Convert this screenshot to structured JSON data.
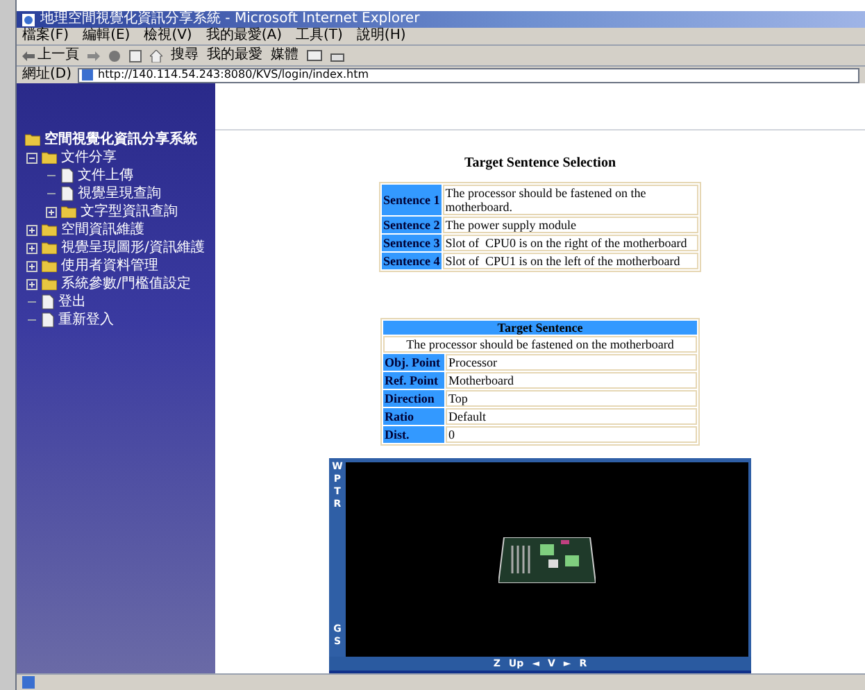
{
  "window": {
    "title": "地理空間視覺化資訊分享系統 - Microsoft Internet Explorer"
  },
  "menu": [
    "檔案(F)",
    "編輯(E)",
    "檢視(V)",
    "我的最愛(A)",
    "工具(T)",
    "說明(H)"
  ],
  "toolbar": {
    "back": "上一頁",
    "search": "搜尋",
    "favorites": "我的最愛",
    "media": "媒體"
  },
  "address": {
    "label": "網址(D)",
    "value": "http://140.114.54.243:8080/KVS/login/index.htm"
  },
  "tree": {
    "label": "空間視覺化資訊分享系統",
    "children": [
      {
        "kind": "folder",
        "label": "文件分享",
        "expanded": true,
        "children": [
          {
            "kind": "document",
            "label": "文件上傳"
          },
          {
            "kind": "document",
            "label": "視覺呈現查詢"
          },
          {
            "kind": "folder",
            "label": "文字型資訊查詢",
            "expanded": false
          }
        ]
      },
      {
        "kind": "folder",
        "label": "空間資訊維護",
        "expanded": false
      },
      {
        "kind": "folder",
        "label": "視覺呈現圖形/資訊維護",
        "expanded": false
      },
      {
        "kind": "folder",
        "label": "使用者資料管理",
        "expanded": false
      },
      {
        "kind": "folder",
        "label": "系統參數/門檻值設定",
        "expanded": false
      },
      {
        "kind": "document",
        "label": "登出"
      },
      {
        "kind": "document",
        "label": "重新登入"
      }
    ]
  },
  "selection": {
    "title": "Target Sentence Selection",
    "rows": [
      {
        "label": "Sentence 1",
        "text": "The processor should be fastened on the motherboard."
      },
      {
        "label": "Sentence 2",
        "text": "The power supply module"
      },
      {
        "label": "Sentence 3",
        "text": "Slot of  CPU0 is on the right of the motherboard"
      },
      {
        "label": "Sentence 4",
        "text": "Slot of  CPU1 is on the left of the motherboard"
      }
    ]
  },
  "target": {
    "title": "Target Sentence",
    "sentence": "The processor should be fastened on the motherboard",
    "rows": [
      {
        "label": "Obj. Point",
        "value": "Processor"
      },
      {
        "label": "Ref. Point",
        "value": "Motherboard"
      },
      {
        "label": "Direction",
        "value": "Top"
      },
      {
        "label": "Ratio",
        "value": "Default"
      },
      {
        "label": "Dist.",
        "value": "0"
      }
    ]
  },
  "viewer": {
    "side_top": [
      "W",
      "P",
      "T",
      "R"
    ],
    "side_bottom": [
      "G",
      "S"
    ],
    "bottom": [
      "Z",
      "Up",
      "◄",
      "V",
      "►",
      "R"
    ]
  }
}
